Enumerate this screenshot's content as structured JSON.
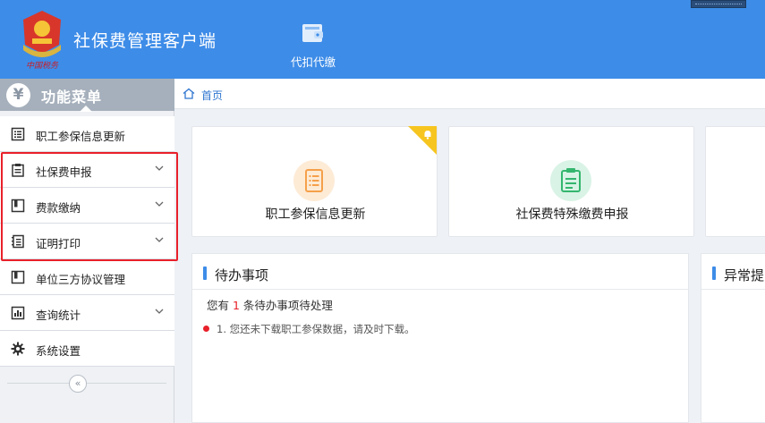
{
  "header": {
    "app_title": "社保费管理客户端",
    "nav": [
      {
        "label": "代扣代缴",
        "icon": "wallet-icon"
      }
    ],
    "logo_icon": "tax-emblem-icon"
  },
  "sidebar": {
    "title": "功能菜单",
    "title_icon": "yen-icon",
    "items": [
      {
        "label": "职工参保信息更新",
        "icon": "list-icon",
        "has_submenu": false
      },
      {
        "label": "社保费申报",
        "icon": "clipboard-icon",
        "has_submenu": true
      },
      {
        "label": "费款缴纳",
        "icon": "book-icon",
        "has_submenu": true
      },
      {
        "label": "证明打印",
        "icon": "document-icon",
        "has_submenu": true
      },
      {
        "label": "单位三方协议管理",
        "icon": "book-icon",
        "has_submenu": false
      },
      {
        "label": "查询统计",
        "icon": "bar-chart-icon",
        "has_submenu": true
      },
      {
        "label": "系统设置",
        "icon": "gear-icon",
        "has_submenu": false
      }
    ],
    "collapse_icon": "double-chevron-left-icon"
  },
  "breadcrumb": {
    "label": "首页",
    "icon": "home-icon"
  },
  "cards": [
    {
      "label": "职工参保信息更新",
      "icon": "document-icon",
      "accent": "#f5a04a"
    },
    {
      "label": "社保费特殊缴费申报",
      "icon": "clipboard-icon",
      "accent": "#34b66e"
    }
  ],
  "todo": {
    "title": "待办事项",
    "summary_prefix": "您有 ",
    "count": "1",
    "summary_suffix": " 条待办事项待处理",
    "items": [
      "1. 您还未下载职工参保数据，请及时下载。"
    ]
  },
  "exceptions": {
    "title": "异常提"
  },
  "colors": {
    "primary": "#3d8ce8",
    "highlight": "#e8202a",
    "badge": "#f7c520"
  }
}
